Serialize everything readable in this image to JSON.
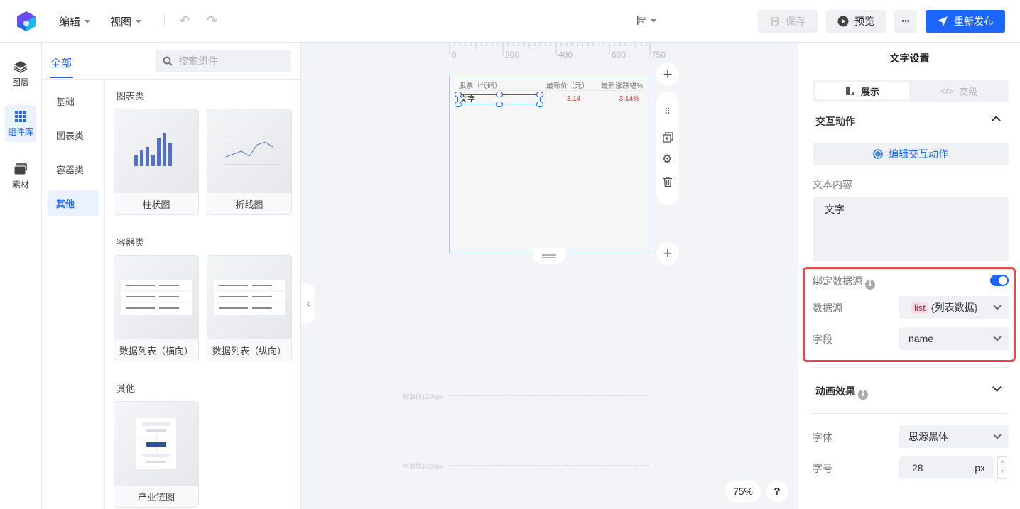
{
  "topbar": {
    "menus": [
      {
        "label": "编辑"
      },
      {
        "label": "视图"
      }
    ],
    "save": "保存",
    "preview": "预览",
    "more": "•••",
    "publish": "重新发布"
  },
  "rail": [
    {
      "label": "图层"
    },
    {
      "label": "组件库"
    },
    {
      "label": "素材"
    }
  ],
  "library": {
    "tab": "全部",
    "search_placeholder": "搜索组件",
    "categories": [
      "基础",
      "图表类",
      "容器类",
      "其他"
    ],
    "sections": [
      {
        "title": "图表类",
        "items": [
          "柱状图",
          "折线图"
        ]
      },
      {
        "title": "容器类",
        "items": [
          "数据列表（横向）",
          "数据列表（纵向）"
        ]
      },
      {
        "title": "其他",
        "items": [
          "产业链图"
        ]
      }
    ]
  },
  "canvas": {
    "ruler": [
      "0",
      "200",
      "400",
      "600",
      "750"
    ],
    "table": {
      "headers": [
        "股票（代码）",
        "最新价（元）",
        "最新涨跌幅%"
      ],
      "row": [
        "文字",
        "3.14",
        "3.14%"
      ]
    },
    "guides": [
      "标准屏1206px",
      "全面屏1468px"
    ],
    "zoom": "75%",
    "help": "?"
  },
  "panel": {
    "title": "文字设置",
    "tabs": [
      "展示",
      "高级"
    ],
    "interaction": "交互动作",
    "edit_interaction": "编辑交互动作",
    "text_content_label": "文本内容",
    "text_content": "文字",
    "bind_label": "绑定数据源",
    "bind_on": true,
    "source_label": "数据源",
    "source_tag": "list",
    "source_value": "{列表数据}",
    "field_label": "字段",
    "field_value": "name",
    "animation": "动画效果",
    "font_label": "字体",
    "font_value": "思源黑体",
    "size_label": "字号",
    "size_value": "28",
    "size_unit": "px"
  },
  "colors": {
    "accent": "#1a66ff",
    "highlight": "#e84a4a",
    "up": "#e03a3a"
  }
}
